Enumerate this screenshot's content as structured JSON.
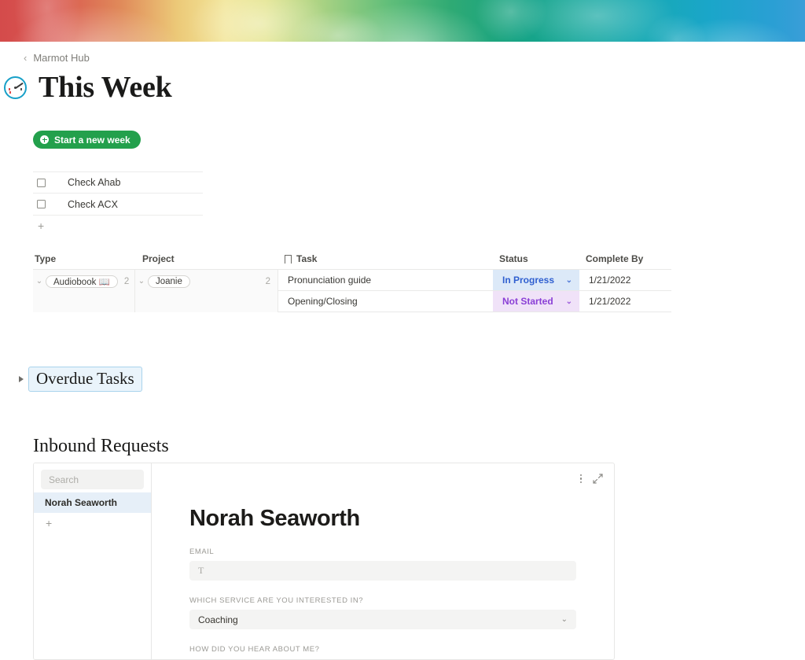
{
  "cover": {
    "name": "rainbow-smoke-cover"
  },
  "breadcrumb": {
    "chevron": "‹",
    "parent": "Marmot Hub"
  },
  "header": {
    "icon": "stopwatch-icon",
    "title": "This Week"
  },
  "toolbar": {
    "start_week_label": "Start a new week",
    "plus_icon": "plus-circle-icon"
  },
  "checklist": {
    "items": [
      {
        "label": "Check Ahab",
        "checked": false
      },
      {
        "label": "Check ACX",
        "checked": false
      }
    ],
    "add_label": "+"
  },
  "table": {
    "columns": [
      {
        "key": "type",
        "label": "Type"
      },
      {
        "key": "project",
        "label": "Project"
      },
      {
        "key": "task",
        "label": "Task",
        "icon": "bookmark-icon"
      },
      {
        "key": "status",
        "label": "Status"
      },
      {
        "key": "date",
        "label": "Complete By"
      }
    ],
    "group": {
      "type_pill": "Audiobook 📖",
      "type_count": "2",
      "project_pill": "Joanie",
      "project_count": "2",
      "chevron": "⌄"
    },
    "rows": [
      {
        "task": "Pronunciation guide",
        "status": "In Progress",
        "status_chevron": "⌄",
        "date": "1/21/2022"
      },
      {
        "task": "Opening/Closing",
        "status": "Not Started",
        "status_chevron": "⌄",
        "date": "1/21/2022"
      }
    ]
  },
  "overdue": {
    "toggle_icon": "triangle-right-icon",
    "label": "Overdue Tasks"
  },
  "inbound": {
    "section_title": "Inbound Requests",
    "search_placeholder": "Search",
    "search_value": "",
    "list": [
      {
        "label": "Norah Seaworth",
        "selected": true
      }
    ],
    "add_label": "+",
    "tools": {
      "kebab": "more-options-icon",
      "expand": "expand-icon"
    },
    "record": {
      "title": "Norah Seaworth",
      "fields": [
        {
          "label": "EMAIL",
          "type": "text",
          "value": "",
          "icon": "text-type-icon"
        },
        {
          "label": "WHICH SERVICE ARE YOU INTERESTED IN?",
          "type": "select",
          "value": "Coaching",
          "chevron": "⌄"
        },
        {
          "label": "HOW DID YOU HEAR ABOUT ME?",
          "type": "label-only",
          "value": ""
        }
      ]
    }
  },
  "colors": {
    "accent_green": "#23a04c",
    "status_in_progress_text": "#2f5fd0",
    "status_in_progress_bg": "#dce9f8",
    "status_not_started_text": "#8a3fd6",
    "status_not_started_bg": "#f0e2f8",
    "selection_blue": "#e6eff8",
    "icon_ring": "#18a0c8"
  }
}
